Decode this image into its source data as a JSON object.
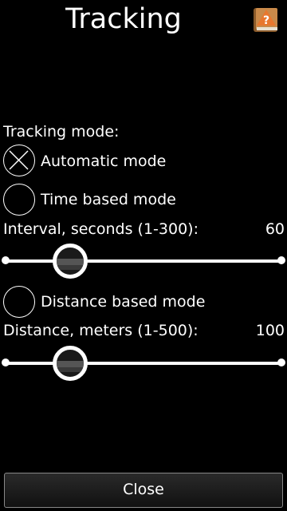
{
  "header": {
    "title": "Tracking",
    "help_icon": "help-book-icon"
  },
  "tracking_mode_label": "Tracking mode:",
  "modes": [
    {
      "label": "Automatic mode",
      "selected": true
    },
    {
      "label": "Time based mode",
      "selected": false
    },
    {
      "label": "Distance based mode",
      "selected": false
    }
  ],
  "interval": {
    "label": "Interval, seconds (1-300):",
    "value": "60",
    "min": 1,
    "max": 300
  },
  "distance": {
    "label": "Distance, meters (1-500):",
    "value": "100",
    "min": 1,
    "max": 500
  },
  "close_label": "Close",
  "colors": {
    "background": "#000000",
    "text": "#ffffff",
    "help_orange": "#e8772e"
  }
}
